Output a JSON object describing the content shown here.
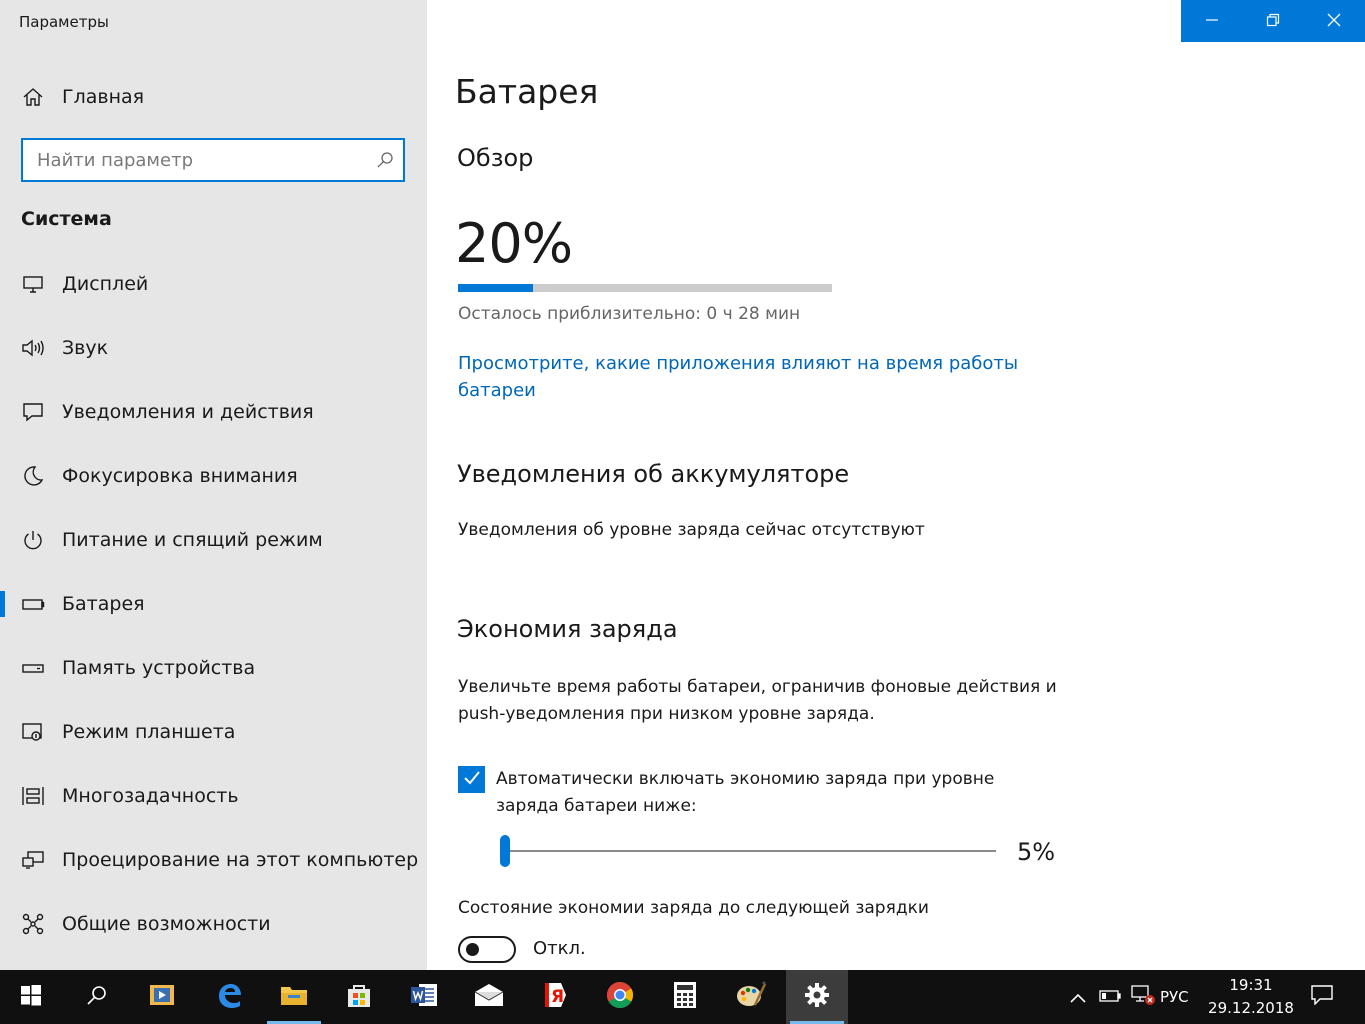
{
  "window": {
    "title": "Параметры",
    "controls": {
      "minimize_icon": "minimize-icon",
      "restore_icon": "restore-icon",
      "close_icon": "close-icon"
    }
  },
  "sidebar": {
    "home_label": "Главная",
    "search": {
      "placeholder": "Найти параметр",
      "value": ""
    },
    "section_heading": "Система",
    "items": [
      {
        "label": "Дисплей",
        "icon": "display-icon"
      },
      {
        "label": "Звук",
        "icon": "speaker-icon"
      },
      {
        "label": "Уведомления и действия",
        "icon": "notification-icon"
      },
      {
        "label": "Фокусировка внимания",
        "icon": "moon-icon"
      },
      {
        "label": "Питание и спящий режим",
        "icon": "power-icon"
      },
      {
        "label": "Батарея",
        "icon": "battery-icon",
        "selected": true
      },
      {
        "label": "Память устройства",
        "icon": "storage-icon"
      },
      {
        "label": "Режим планшета",
        "icon": "tablet-icon"
      },
      {
        "label": "Многозадачность",
        "icon": "multitasking-icon"
      },
      {
        "label": "Проецирование на этот компьютер",
        "icon": "projecting-icon"
      },
      {
        "label": "Общие возможности",
        "icon": "shared-experiences-icon"
      }
    ]
  },
  "main": {
    "title": "Батарея",
    "overview": {
      "heading": "Обзор",
      "percent_text": "20%",
      "charge_level": 0.2,
      "time_left": "Осталось приблизительно: 0 ч 28 мин",
      "apps_link": "Просмотрите, какие приложения влияют на время работы батареи"
    },
    "notifications": {
      "heading": "Уведомления об аккумуляторе",
      "text": "Уведомления об уровне заряда сейчас отсутствуют"
    },
    "battery_saver": {
      "heading": "Экономия заряда",
      "description": "Увеличьте время работы батареи, ограничив фоновые действия и push-уведомления при низком уровне заряда.",
      "auto_checkbox": {
        "checked": true,
        "label": "Автоматически включать экономию заряда при уровне заряда батареи ниже:"
      },
      "threshold_slider": {
        "value": 5,
        "min": 5,
        "max": 100,
        "value_text": "5%"
      },
      "state_label": "Состояние экономии заряда до следующей зарядки",
      "state_toggle": {
        "on": false,
        "value_text": "Откл."
      }
    }
  },
  "taskbar": {
    "apps": [
      {
        "name": "start",
        "icon": "windows-logo-icon"
      },
      {
        "name": "search",
        "icon": "search-icon"
      },
      {
        "name": "task-view",
        "icon": "media-player-icon"
      },
      {
        "name": "edge",
        "icon": "edge-icon"
      },
      {
        "name": "file-explorer",
        "icon": "folder-icon",
        "open": true
      },
      {
        "name": "store",
        "icon": "store-icon"
      },
      {
        "name": "word",
        "icon": "word-icon"
      },
      {
        "name": "mail",
        "icon": "mail-icon"
      },
      {
        "name": "yandex",
        "icon": "yandex-icon"
      },
      {
        "name": "chrome",
        "icon": "chrome-icon"
      },
      {
        "name": "calculator",
        "icon": "calculator-icon"
      },
      {
        "name": "paint",
        "icon": "paint-icon"
      },
      {
        "name": "settings",
        "icon": "gear-icon",
        "open": true,
        "active": true
      }
    ],
    "tray": {
      "chevron_icon": "chevron-up-icon",
      "battery_icon": "battery-tray-icon",
      "network_icon": "network-disconnected-icon",
      "language": "РУС",
      "time": "19:31",
      "date": "29.12.2018",
      "notification_icon": "action-center-icon"
    }
  },
  "colors": {
    "accent": "#0078d7",
    "link": "#0067b8",
    "sidebar_bg": "#e6e6e6",
    "taskbar_bg": "#101010"
  }
}
